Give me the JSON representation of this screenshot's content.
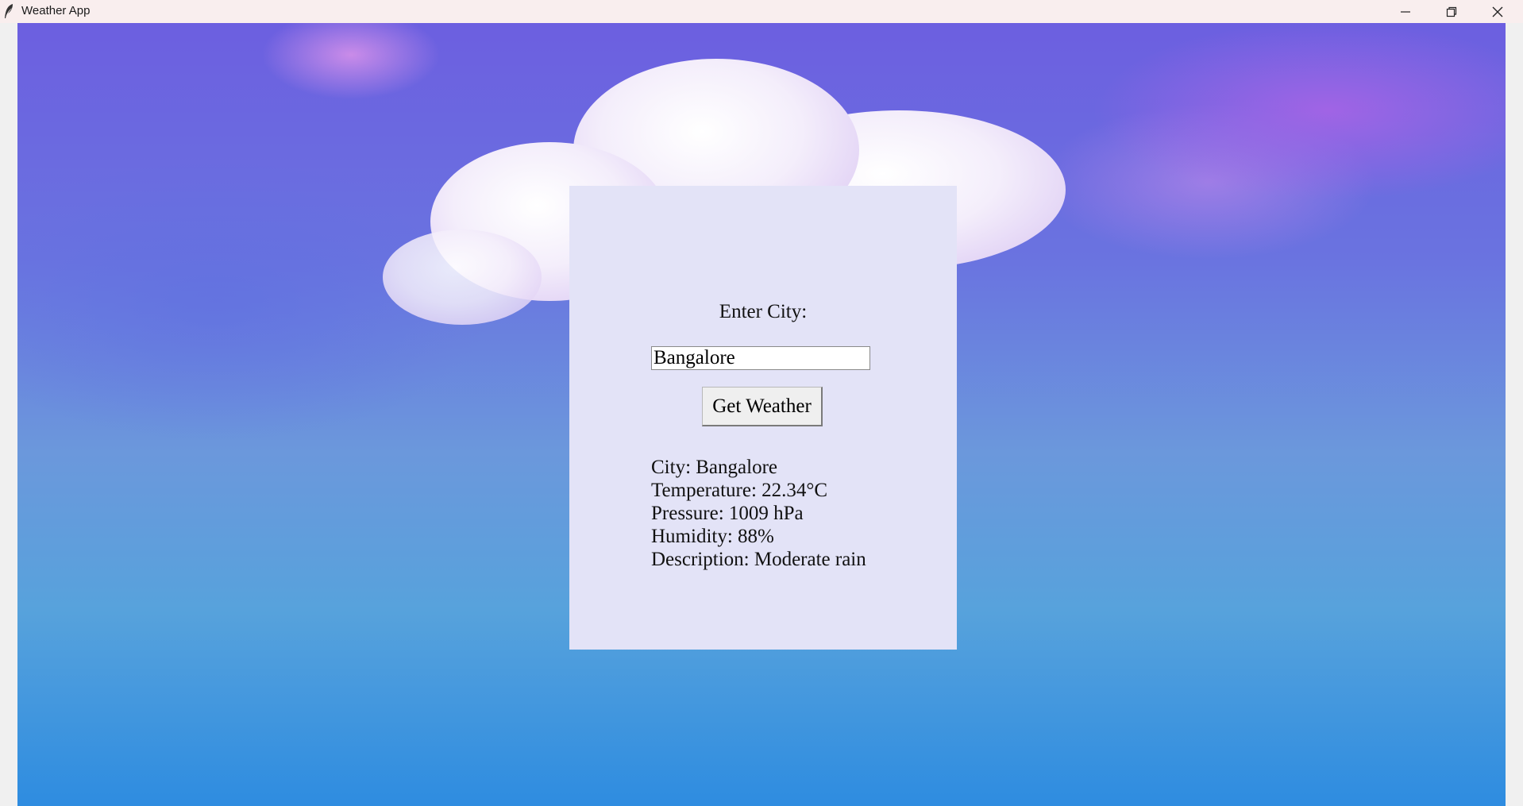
{
  "window": {
    "title": "Weather App",
    "icon": "feather-icon"
  },
  "controls": {
    "minimize": "minimize-icon",
    "maximize": "restore-icon",
    "close": "close-icon"
  },
  "form": {
    "label": "Enter City:",
    "city_value": "Bangalore",
    "button_label": "Get Weather"
  },
  "results": {
    "city": "City: Bangalore",
    "temperature": "Temperature: 22.34°C",
    "pressure": "Pressure: 1009 hPa",
    "humidity": "Humidity: 88%",
    "description": "Description: Moderate rain"
  },
  "colors": {
    "panel": "#e3e3f7",
    "titlebar": "#f9eeee",
    "sky_top": "#6c5fe0",
    "sky_bottom": "#2e8ce0"
  }
}
